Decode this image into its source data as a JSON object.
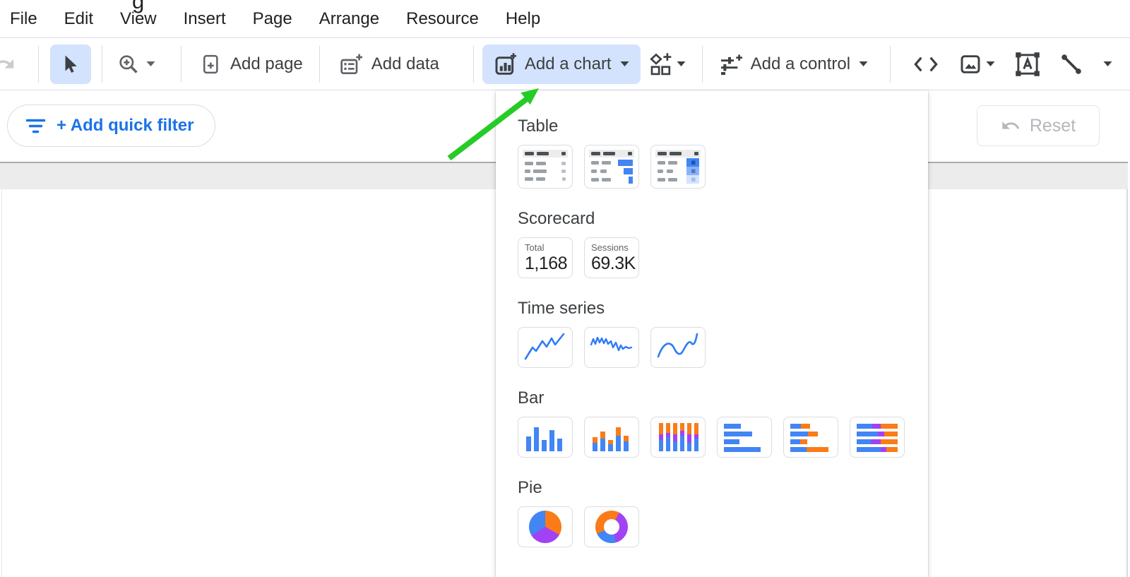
{
  "window": {
    "title_fragment": "g"
  },
  "menubar": {
    "items": [
      "File",
      "Edit",
      "View",
      "Insert",
      "Page",
      "Arrange",
      "Resource",
      "Help"
    ]
  },
  "toolbar": {
    "add_page_label": "Add page",
    "add_data_label": "Add data",
    "add_chart_label": "Add a chart",
    "add_control_label": "Add a control",
    "icons": [
      "redo-icon",
      "select-cursor-icon",
      "zoom-in-icon",
      "add-page-icon",
      "add-data-icon",
      "add-chart-icon",
      "community-visualizations-icon",
      "add-control-icon",
      "embed-code-icon",
      "image-icon",
      "text-box-icon",
      "line-icon"
    ]
  },
  "filter_bar": {
    "add_quick_filter_label": "+ Add quick filter",
    "reset_label": "Reset"
  },
  "chart_menu": {
    "sections": [
      {
        "label": "Table",
        "items": [
          "table",
          "table-with-bars",
          "table-with-heatmap"
        ]
      },
      {
        "label": "Scorecard",
        "cards": [
          {
            "label": "Total",
            "value": "1,168"
          },
          {
            "label": "Sessions",
            "value": "69.3K"
          }
        ]
      },
      {
        "label": "Time series",
        "items": [
          "time-series",
          "sparkline",
          "smoothed-time-series"
        ]
      },
      {
        "label": "Bar",
        "items": [
          "column-chart",
          "stacked-column-chart",
          "100-percent-stacked-column-chart",
          "bar-chart",
          "stacked-bar-chart",
          "100-percent-stacked-bar-chart"
        ]
      },
      {
        "label": "Pie",
        "items": [
          "pie-chart",
          "donut-chart"
        ]
      }
    ]
  },
  "colors": {
    "accent_blue": "#1a73e8",
    "chart_blue": "#4285f4",
    "chart_orange": "#fa7b17",
    "chart_purple": "#a142f4",
    "button_highlight": "#d3e3fd",
    "arrow_green": "#26cc26",
    "disabled_gray": "#b4b7bc"
  }
}
